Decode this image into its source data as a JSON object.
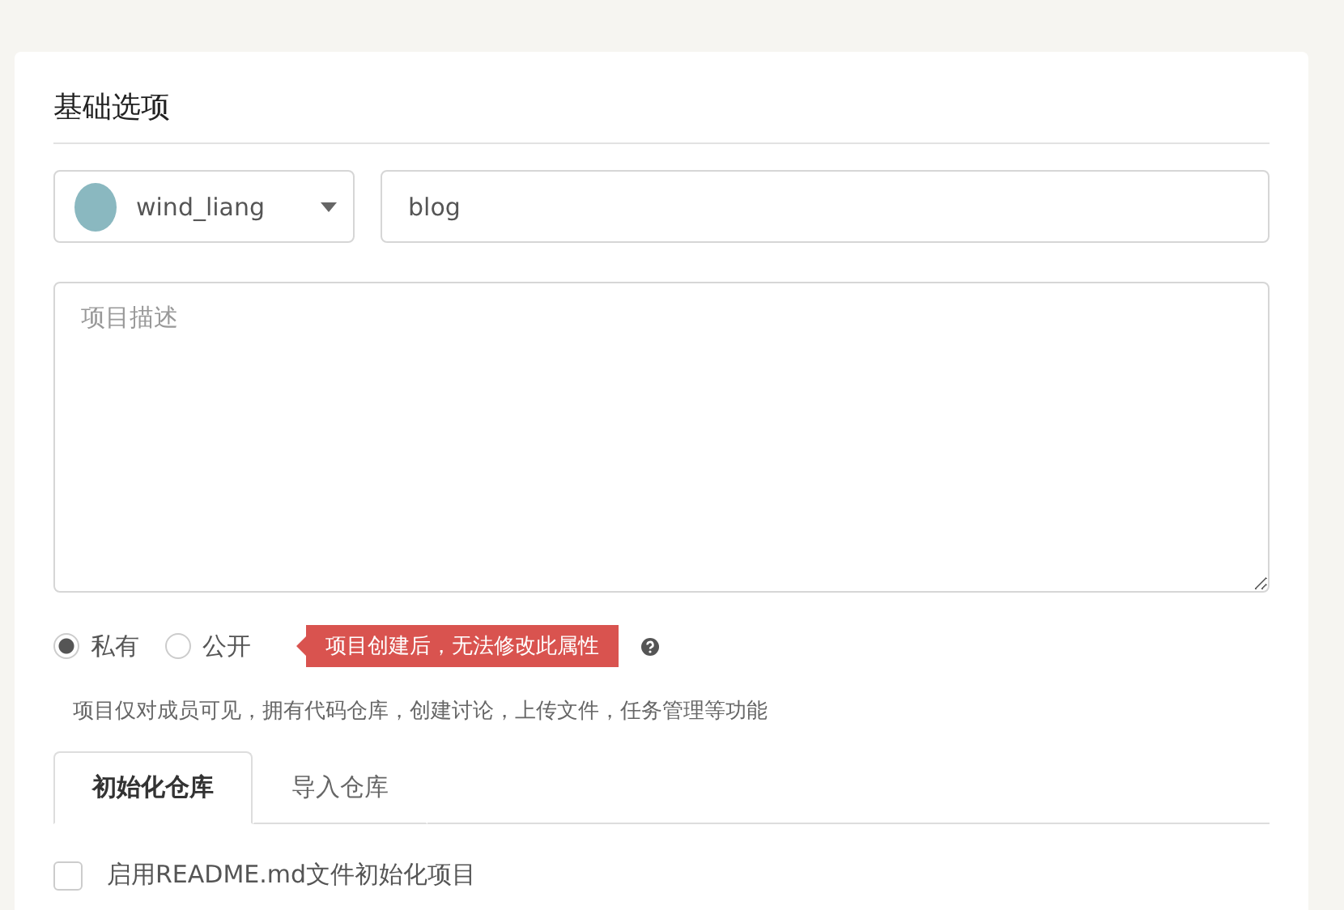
{
  "section": {
    "title": "基础选项"
  },
  "owner": {
    "name": "wind_liang"
  },
  "project_name": {
    "value": "blog"
  },
  "description": {
    "placeholder": "项目描述"
  },
  "visibility": [
    {
      "label": "私有",
      "selected": true
    },
    {
      "label": "公开",
      "selected": false
    }
  ],
  "warning_tag": "项目创建后，无法修改此属性",
  "visibility_hint": "项目仅对成员可见，拥有代码仓库，创建讨论，上传文件，任务管理等功能",
  "tabs": [
    {
      "label": "初始化仓库",
      "selected": true
    },
    {
      "label": "导入仓库",
      "selected": false
    }
  ],
  "readme_option": {
    "label": "启用README.md文件初始化项目",
    "checked": false
  }
}
